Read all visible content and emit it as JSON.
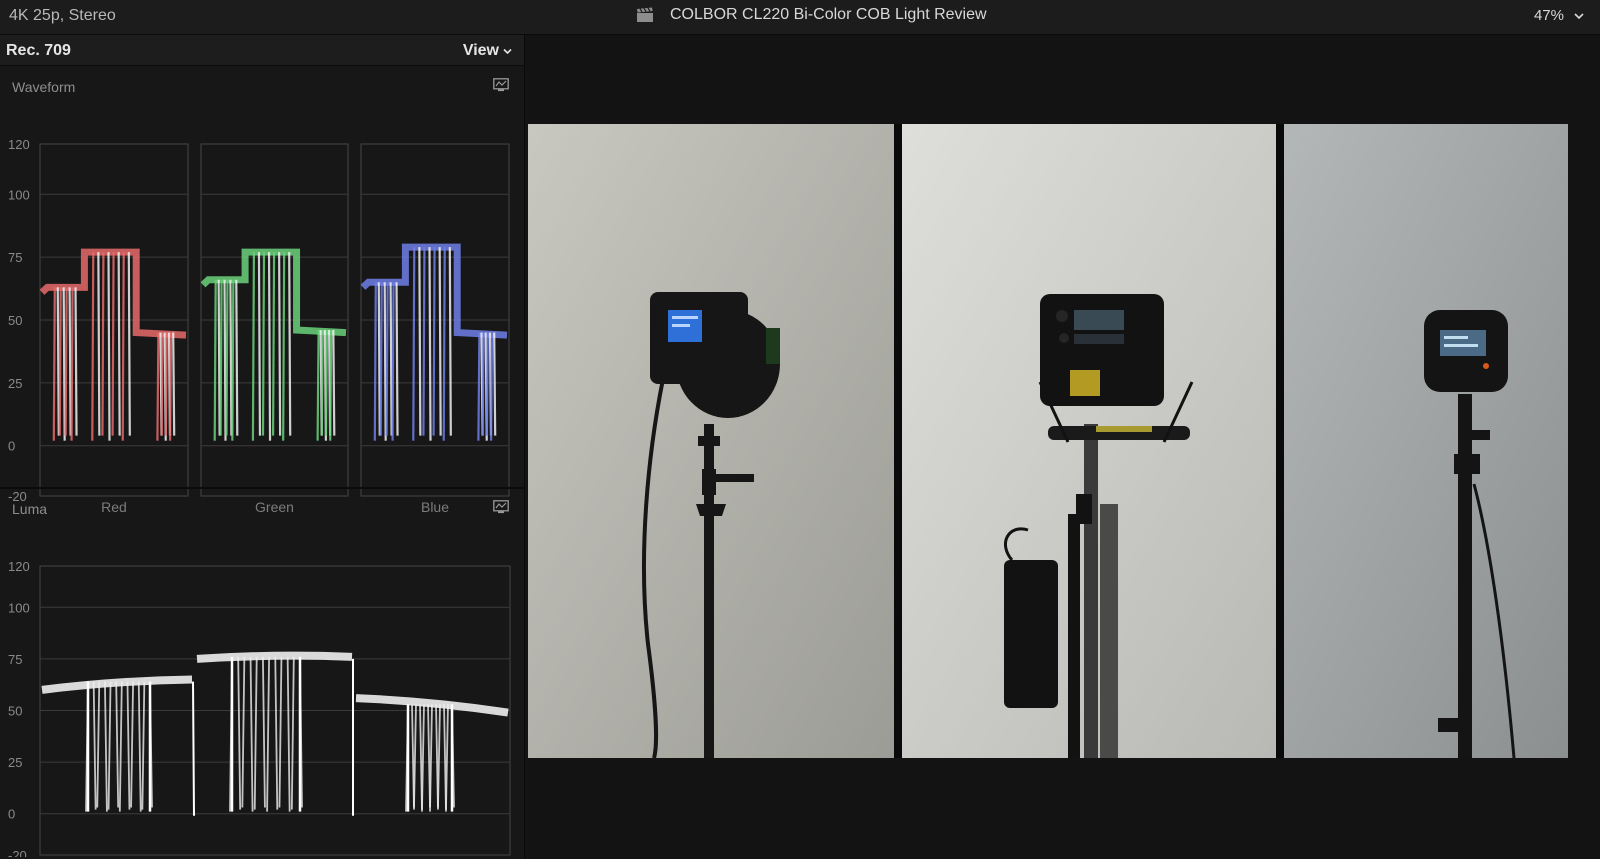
{
  "topbar": {
    "format": "4K 25p, Stereo",
    "title": "COLBOR CL220 Bi-Color COB Light Review",
    "zoom": "47%",
    "clapper_icon": "clapperboard-icon",
    "zoom_menu_icon": "chevron-down-icon"
  },
  "scopes": {
    "standard": "Rec. 709",
    "view_label": "View",
    "waveform": {
      "label": "Waveform",
      "settings_icon": "scope-settings-icon",
      "ticks": [
        "120",
        "100",
        "75",
        "50",
        "25",
        "0",
        "-20"
      ],
      "channels": [
        {
          "name": "Red",
          "color": "#e86a6a"
        },
        {
          "name": "Green",
          "color": "#6ad27a"
        },
        {
          "name": "Blue",
          "color": "#6f7fe8"
        }
      ]
    },
    "luma": {
      "label": "Luma",
      "settings_icon": "scope-settings-icon",
      "ticks": [
        "120",
        "100",
        "75",
        "50",
        "25",
        "0",
        "-20"
      ]
    }
  },
  "viewer": {
    "content": "three-panel light comparison"
  }
}
